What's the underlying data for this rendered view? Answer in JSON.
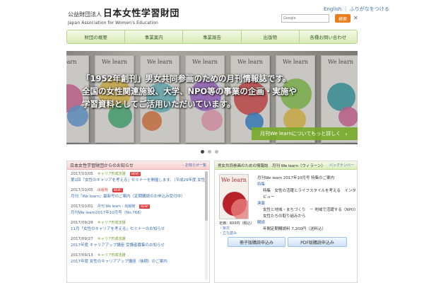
{
  "header": {
    "org_type": "公益財団法人",
    "org_name": "日本女性学習財団",
    "org_en": "Japan Association for Women's Education",
    "lang_link": "English ｜ ふりがなをつける",
    "search_placeholder": "Google",
    "search_button": "検索",
    "clear_glyph": "✕"
  },
  "nav": {
    "items": [
      "財団の概要",
      "事業案内",
      "事業報告",
      "出版物",
      "各種お問い合わせ"
    ]
  },
  "hero": {
    "lines": [
      "「1952年創刊」男女共同参画のための月刊情報誌です。",
      "全国の女性関連施設、大学、NPO等の事業の企画・実施や",
      "学習資料としてご活用いただいています。"
    ],
    "link_label": "月刊We learnについてもっと詳しく",
    "link_arrow": "›",
    "magazine_title": "We learn",
    "magazine_edge": "learn"
  },
  "slider": {
    "count": 3,
    "active": 0
  },
  "news": {
    "title": "日本女性学習財団からのお知らせ",
    "list_link": "お知らせ一覧",
    "collapse_glyph": "-",
    "new_label": "NEW!",
    "items": [
      {
        "date": "2017/10/05",
        "category": "キャリア形成支援",
        "is_new": true,
        "title": "第1回「女性のキャリアを考える」セミナーを開催します。（平成29年度 女性のためのキャリアアップ講座）"
      },
      {
        "date": "2017/10/05",
        "category": "出版物",
        "is_new": true,
        "title": "月刊『We learn』最新号のご案内（定期購読のお申込み受付中）"
      },
      {
        "date": "2017/10/01",
        "category": "月刊 We learn・出版物",
        "is_new": true,
        "title": "月刊We learn2017年10月号（No.768）"
      },
      {
        "date": "2017/09/28",
        "category": "キャリア形成支援",
        "is_new": false,
        "title": "11月「女性のキャリアを考える」セミナーのお知らせ"
      },
      {
        "date": "2017/09/27",
        "category": "キャリア形成支援",
        "is_new": false,
        "title": "2017年度 キャリアアップ講座 受講者募集のお知らせ"
      },
      {
        "date": "2017/09/13",
        "category": "キャリア形成支援",
        "is_new": false,
        "title": "2017年度 女性のキャリアアップ講座（後期）のご案内"
      }
    ]
  },
  "magazine": {
    "title": "男女共同参画のための情報誌　月刊 We learn（ウィラーン）",
    "list_link": "バックナンバー",
    "cover_title": "We learn",
    "price": "定価：600円（税込）",
    "side_links": [
      "・目次",
      "・立ち読み"
    ],
    "info": [
      {
        "text": "月刊We learn 2017年10月号 特集のご案内",
        "kind": "text"
      },
      {
        "text": "特集",
        "kind": "label"
      },
      {
        "text": "特集　女性の活躍とライフスタイルを考える　インタビュー",
        "kind": "indent"
      },
      {
        "text": "連載",
        "kind": "label"
      },
      {
        "text": "女性と地域・まちづくり　－ 地域で活躍する（NPO）女性たちの取り組みから",
        "kind": "indent"
      },
      {
        "text": "購読",
        "kind": "label"
      },
      {
        "text": "年間定期購読料 7,200円（送料込）",
        "kind": "indent"
      }
    ],
    "buttons": [
      "冊子版購読申込み",
      "PDF版購読申込み"
    ]
  }
}
